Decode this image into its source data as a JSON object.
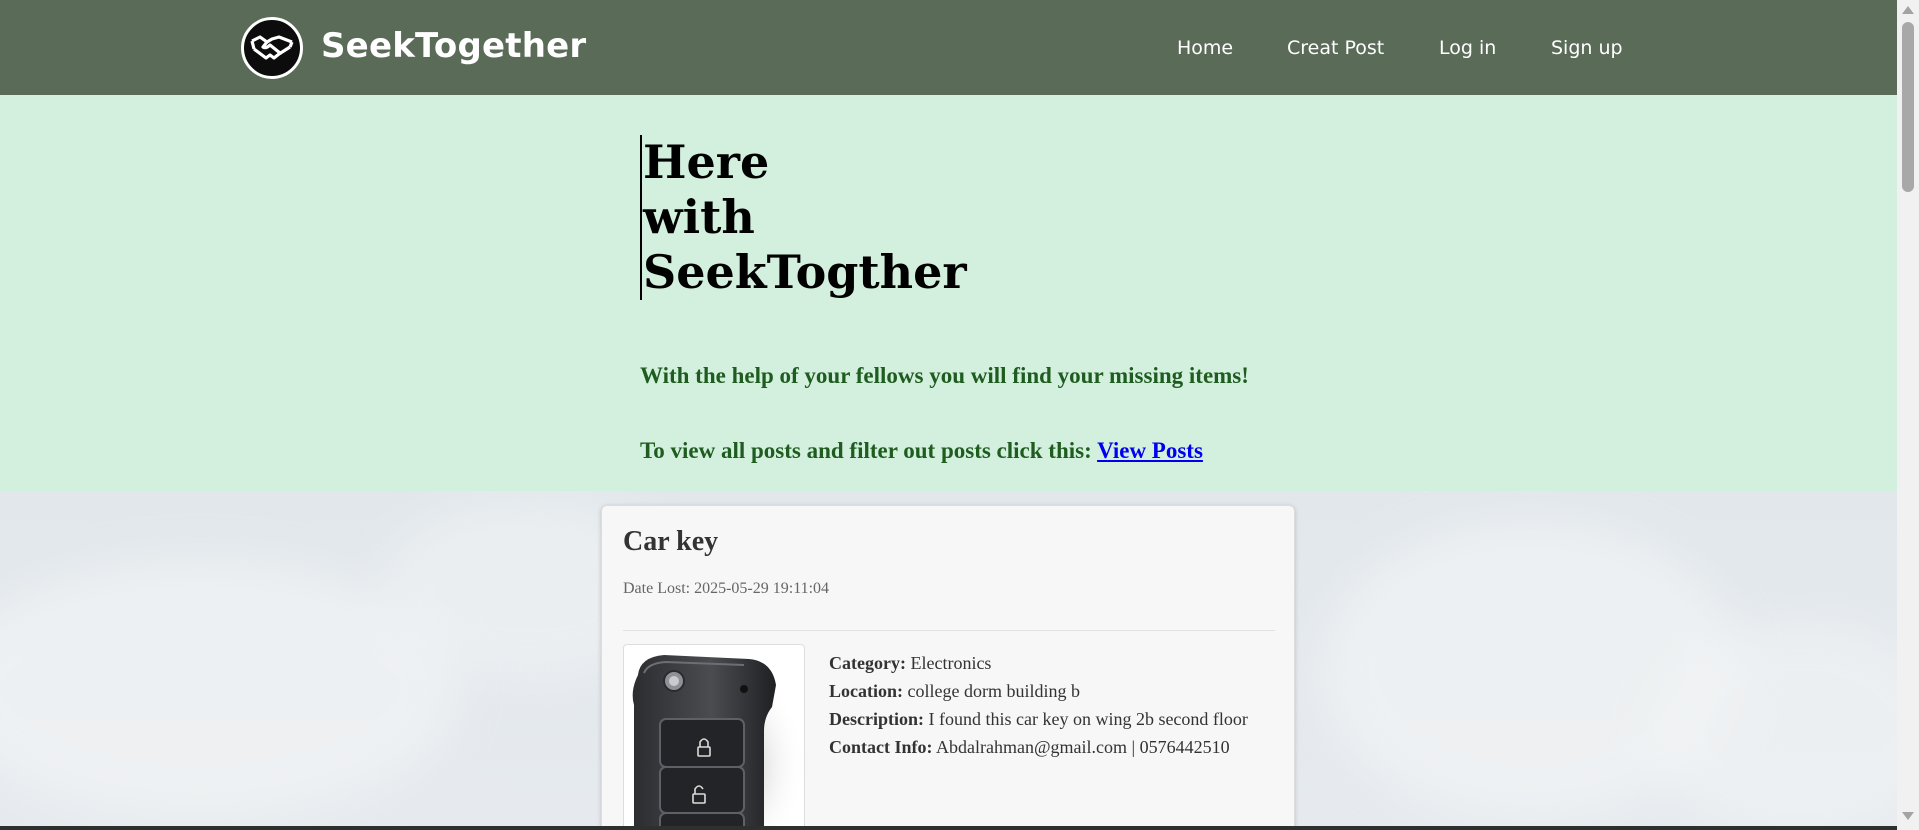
{
  "navbar": {
    "brand": "SeekTogether",
    "logo_icon": "handshake-icon",
    "links": [
      "Home",
      "Creat Post",
      "Log in",
      "Sign up"
    ]
  },
  "hero": {
    "title_lines": [
      "Here",
      "with",
      "SeekTogther"
    ],
    "subtitle": "With the help of your fellows you will find your missing items!",
    "view_prompt": "To view all posts and filter out posts click this:",
    "view_link": "View Posts"
  },
  "post": {
    "title": "Car key",
    "date_label": "Date Lost:",
    "date_value": "2025-05-29 19:11:04",
    "image_icon": "car-key-icon",
    "details": [
      {
        "label": "Category:",
        "value": "Electronics"
      },
      {
        "label": "Location:",
        "value": "college dorm building b"
      },
      {
        "label": "Description:",
        "value": "I found this car key on wing 2b second floor"
      },
      {
        "label": "Contact Info:",
        "value": "Abdalrahman@gmail.com | 0576442510"
      }
    ]
  },
  "colors": {
    "navbar": "#5a6c58",
    "hero_bg": "#d3f0df",
    "hero_text": "#1f5c1f",
    "link": "#0000ee"
  }
}
